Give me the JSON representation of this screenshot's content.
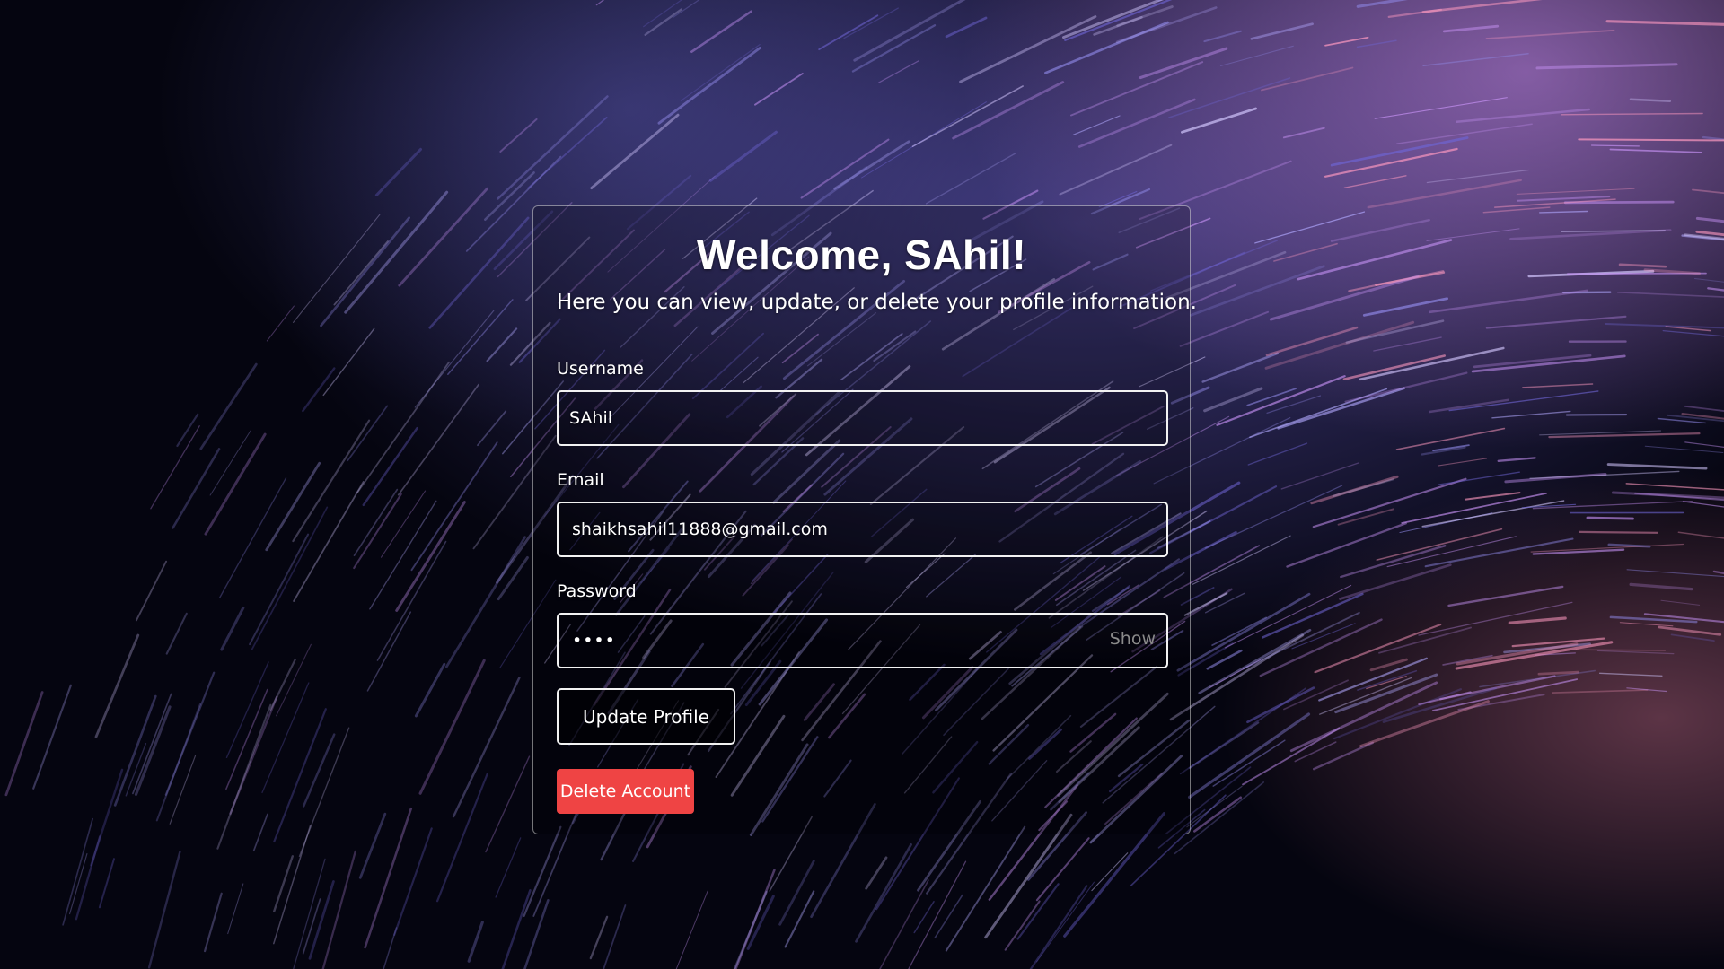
{
  "background": {
    "accent_colors": [
      "#6e64d2",
      "#dc96ff",
      "#ff8caa"
    ]
  },
  "profile": {
    "title": "Welcome, SAhil!",
    "subtitle": "Here you can view, update, or delete your profile information."
  },
  "form": {
    "username_label": "Username",
    "username_value": "SAhil",
    "email_label": "Email",
    "email_value": "shaikhsahil11888@gmail.com",
    "password_label": "Password",
    "password_value": "••••",
    "show_label": "Show"
  },
  "actions": {
    "update_label": "Update Profile",
    "delete_label": "Delete Account",
    "delete_color": "#ef4444"
  }
}
